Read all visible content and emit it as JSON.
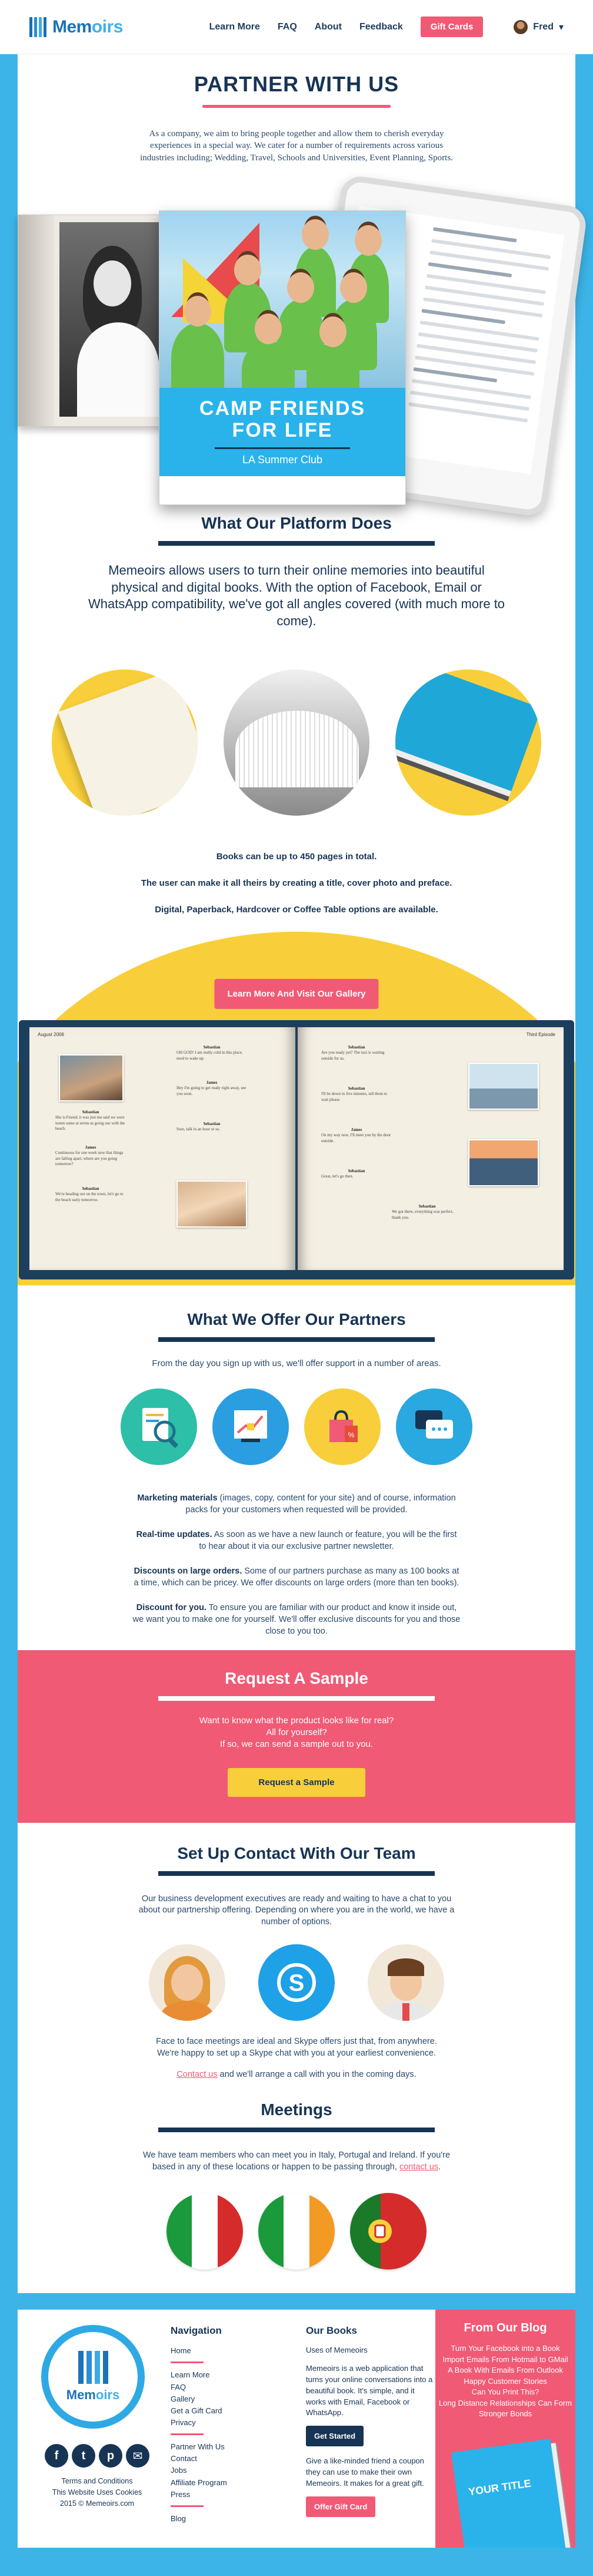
{
  "nav": {
    "brand_main": "Mem",
    "brand_accent": "oirs",
    "links": [
      "Learn More",
      "FAQ",
      "About",
      "Feedback"
    ],
    "gift_cards": "Gift Cards",
    "user": "Fred",
    "user_caret": "▾"
  },
  "hero": {
    "title": "PARTNER WITH US",
    "intro": "As a company, we aim to bring people together and allow them to cherish everyday experiences in a special way. We cater for a number of requirements across various industries including; Wedding, Travel, Schools and Universities, Event Planning, Sports.",
    "cover_title_1": "CAMP FRIENDS",
    "cover_title_2": "FOR LIFE",
    "cover_subtitle": "LA Summer Club"
  },
  "platform": {
    "title": "What Our Platform Does",
    "lead": "Memeoirs allows users to turn their online memories into beautiful physical and digital books. With the option of Facebook, Email or WhatsApp compatibility, we've got all angles covered (with much more to come).",
    "facts": [
      "Books can be up to 450 pages in total.",
      "The user can make it all theirs by creating a title, cover photo and preface.",
      "Digital, Paperback, Hardcover or Coffee Table options are available."
    ]
  },
  "gallery": {
    "button": "Learn More And Visit Our Gallery",
    "left_header": "August 2006",
    "right_header": "Third Episode"
  },
  "offer": {
    "title": "What We Offer Our Partners",
    "subtitle": "From the day you sign up with us, we'll offer support in a number of areas.",
    "items": [
      {
        "head": "Marketing materials",
        "text": " (images, copy, content for your site) and of course, information packs for your customers when requested will be provided."
      },
      {
        "head": "Real-time updates.",
        "text": " As soon as we have a new launch or feature, you will be the first to hear about it via our exclusive partner newsletter."
      },
      {
        "head": "Discounts on large orders.",
        "text": " Some of our partners purchase as many as 100 books at a time, which can be pricey. We offer discounts on large orders (more than ten books)."
      },
      {
        "head": "Discount for you.",
        "text": " To ensure you are familiar with our product and know it inside out, we want you to make one for yourself. We'll offer exclusive discounts for you and those close to you too."
      }
    ]
  },
  "sample": {
    "title": "Request A Sample",
    "line1": "Want to know what the product looks like for real?",
    "line2": "All for yourself?",
    "line3": "If so, we can send a sample out to you.",
    "button": "Request a Sample"
  },
  "contact": {
    "title": "Set Up Contact With Our Team",
    "intro": "Our business development executives are ready and waiting to have a chat to you about our partnership offering. Depending on where you are in the world, we have a number of options.",
    "meet_line1": "Face to face meetings are ideal and Skype offers just that, from anywhere.",
    "meet_line2": "We're happy to set up a Skype chat with you at your earliest convenience.",
    "link": "Contact us",
    "after_link": " and we'll arrange a call with you in the coming days."
  },
  "meetings": {
    "title": "Meetings",
    "text": "We have team members who can meet you in Italy, Portugal and Ireland. If you're based in any of these locations or happen to be passing through, ",
    "link": "contact us",
    "after": "."
  },
  "footer": {
    "brand_main": "Mem",
    "brand_accent": "oirs",
    "social": [
      "f",
      "t",
      "p",
      "✉"
    ],
    "small": [
      "Terms and Conditions",
      "This Website Uses Cookies",
      "2015 © Memeoirs.com"
    ],
    "nav_title": "Navigation",
    "nav_groups": [
      [
        "Home"
      ],
      [
        "Learn More",
        "FAQ",
        "Gallery",
        "Get a Gift Card",
        "Privacy"
      ],
      [
        "Partner With Us",
        "Contact",
        "Jobs",
        "Affiliate Program",
        "Press"
      ],
      [
        "Blog"
      ]
    ],
    "books_title": "Our Books",
    "books_uses": "Uses of Memeoirs",
    "books_desc": "Memeoirs is a web application that turns your online conversations into a beautiful book. It's simple, and it works with Email, Facebook or WhatsApp.",
    "get_started": "Get Started",
    "gift_desc": "Give a like-minded friend a coupon they can use to make their own Memeoirs. It makes for a great gift.",
    "offer_gift": "Offer Gift Card",
    "blog_title": "From Our Blog",
    "blog_links": [
      "Turn Your Facebook into a Book",
      "Import Emails From Hotmail to GMail",
      "A Book With Emails From Outlook",
      "Happy Customer Stories",
      "Can You Print This?",
      "Long Distance Relationships Can Form",
      "Stronger Bonds"
    ],
    "blog_book_title": "YOUR TITLE"
  },
  "colors": {
    "brand_blue": "#1d72b8",
    "sky": "#3db4e8",
    "pink": "#f05a75",
    "yellow": "#f8cf3a",
    "navy": "#173454"
  }
}
